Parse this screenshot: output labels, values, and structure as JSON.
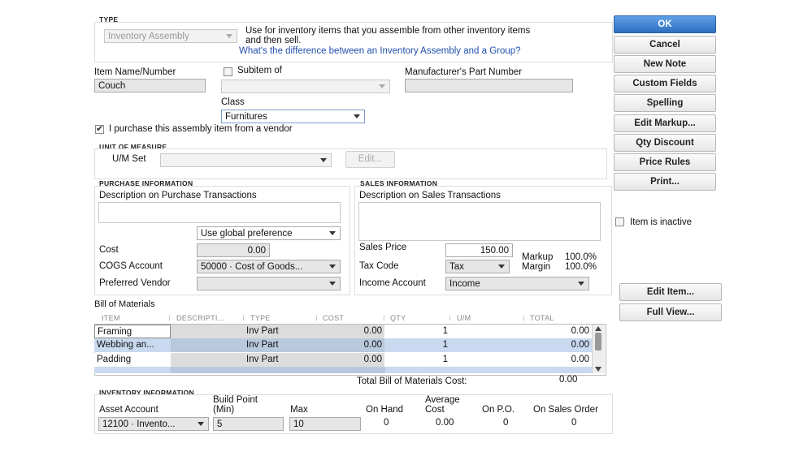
{
  "type_section": {
    "label": "TYPE",
    "selected": "Inventory Assembly",
    "description": "Use for inventory items that you assemble from other inventory items and then sell.",
    "description_line1": "Use for inventory items that you assemble from other inventory items",
    "description_line2": "and then sell.",
    "link": "What's the difference between an Inventory Assembly and a Group?"
  },
  "item": {
    "name_label": "Item Name/Number",
    "name_value": "Couch",
    "subitem_label": "Subitem of",
    "subitem_checked": false,
    "subitem_value": "",
    "mpn_label": "Manufacturer's Part Number",
    "mpn_value": "",
    "class_label": "Class",
    "class_value": "Furnitures",
    "purchase_from_vendor_label": "I purchase this assembly item from a vendor",
    "purchase_from_vendor_checked": true
  },
  "unit_of_measure": {
    "label": "UNIT OF MEASURE",
    "um_set_label": "U/M Set",
    "um_set_value": "",
    "edit_label": "Edit..."
  },
  "purchase": {
    "label": "PURCHASE INFORMATION",
    "desc_label": "Description on Purchase Transactions",
    "desc_value": "",
    "preference": "Use global preference",
    "cost_label": "Cost",
    "cost_value": "0.00",
    "cogs_label": "COGS Account",
    "cogs_value": "50000 · Cost of Goods...",
    "vendor_label": "Preferred Vendor",
    "vendor_value": ""
  },
  "sales": {
    "label": "SALES INFORMATION",
    "desc_label": "Description on Sales Transactions",
    "desc_value": "",
    "price_label": "Sales Price",
    "price_value": "150.00",
    "tax_label": "Tax Code",
    "tax_value": "Tax",
    "income_label": "Income Account",
    "income_value": "Income",
    "markup_label": "Markup",
    "markup_value": "100.0%",
    "margin_label": "Margin",
    "margin_value": "100.0%"
  },
  "bom": {
    "label": "Bill of Materials",
    "columns": [
      "ITEM",
      "DESCRIPTI...",
      "TYPE",
      "COST",
      "QTY",
      "U/M",
      "TOTAL"
    ],
    "rows": [
      {
        "item": "Framing",
        "description": "",
        "type": "Inv Part",
        "cost": "0.00",
        "qty": "1",
        "um": "",
        "total": "0.00"
      },
      {
        "item": "Webbing an...",
        "description": "",
        "type": "Inv Part",
        "cost": "0.00",
        "qty": "1",
        "um": "",
        "total": "0.00"
      },
      {
        "item": "Padding",
        "description": "",
        "type": "Inv Part",
        "cost": "0.00",
        "qty": "1",
        "um": "",
        "total": "0.00"
      }
    ],
    "total_label": "Total Bill of Materials Cost:",
    "total_value": "0.00"
  },
  "inventory": {
    "label": "INVENTORY INFORMATION",
    "asset_label": "Asset Account",
    "asset_value": "12100 · Invento...",
    "build_point_label_1": "Build Point",
    "build_point_label_2": "(Min)",
    "build_point_value": "5",
    "max_label": "Max",
    "max_value": "10",
    "on_hand_label": "On Hand",
    "on_hand_value": "0",
    "avg_cost_label_1": "Average",
    "avg_cost_label_2": "Cost",
    "avg_cost_value": "0.00",
    "on_po_label": "On P.O.",
    "on_po_value": "0",
    "on_so_label": "On Sales Order",
    "on_so_value": "0"
  },
  "buttons": {
    "ok": "OK",
    "cancel": "Cancel",
    "new_note": "New Note",
    "custom_fields": "Custom Fields",
    "spelling": "Spelling",
    "edit_markup": "Edit Markup...",
    "qty_discount": "Qty Discount",
    "price_rules": "Price Rules",
    "print": "Print...",
    "edit_item": "Edit Item...",
    "full_view": "Full View..."
  },
  "inactive": {
    "label": "Item is inactive",
    "checked": false
  },
  "colors": {
    "ok_button": "#2e6fc1",
    "link": "#1f4fae",
    "selected_row": "#c9daf0"
  }
}
